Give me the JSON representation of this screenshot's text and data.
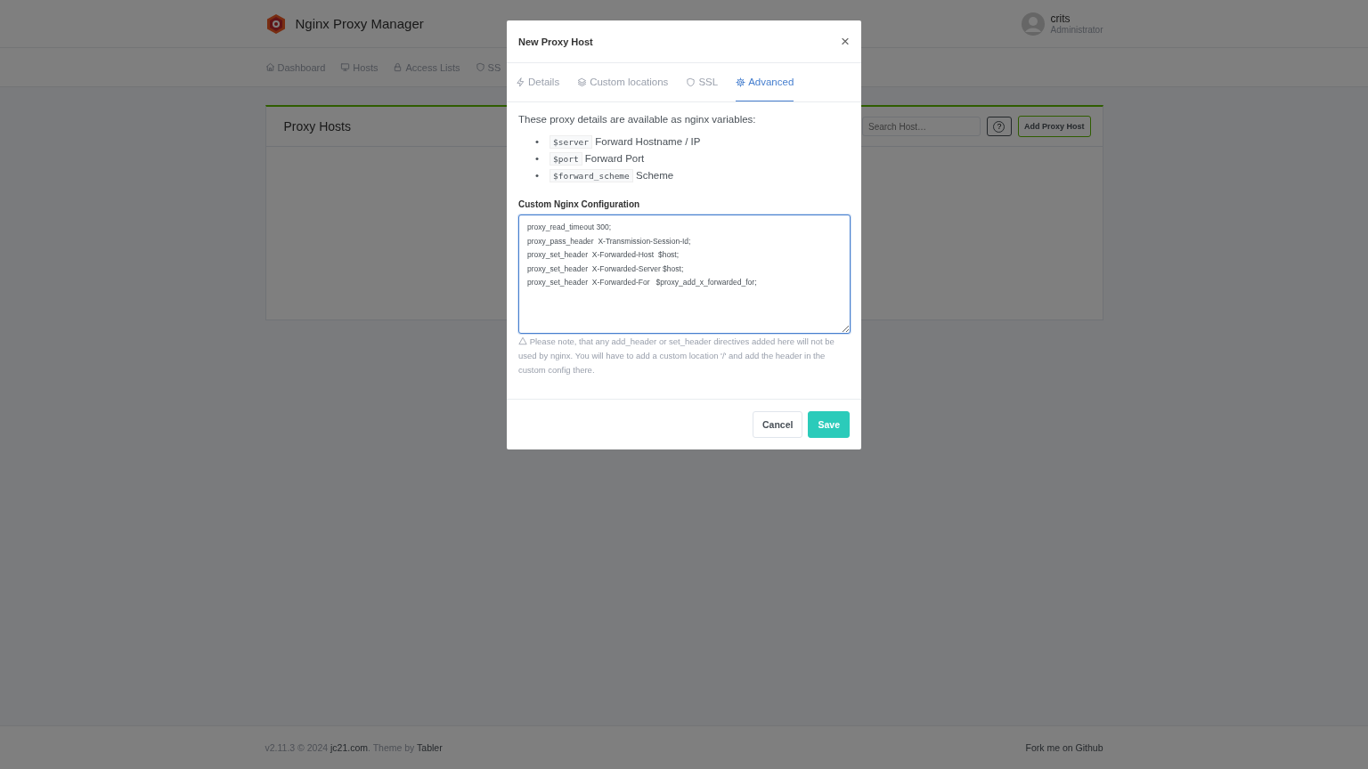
{
  "header": {
    "app_name": "Nginx Proxy Manager",
    "user": {
      "name": "crits",
      "role": "Administrator"
    }
  },
  "nav": [
    {
      "label": "Dashboard"
    },
    {
      "label": "Hosts"
    },
    {
      "label": "Access Lists"
    },
    {
      "label": "SS"
    }
  ],
  "card": {
    "title": "Proxy Hosts",
    "search": {
      "placeholder": "Search Host…"
    },
    "help_button": "?",
    "add_button": "Add Proxy Host"
  },
  "modal": {
    "title": "New Proxy Host",
    "close": "×",
    "tabs": [
      {
        "label": "Details",
        "selected": false
      },
      {
        "label": "Custom locations",
        "selected": false
      },
      {
        "label": "SSL",
        "selected": false
      },
      {
        "label": "Advanced",
        "selected": true
      }
    ],
    "intro": "These proxy details are available as nginx variables:",
    "variables": [
      {
        "bullet": "•",
        "code": "$server",
        "description": "Forward Hostname / IP"
      },
      {
        "bullet": "•",
        "code": "$port",
        "description": "Forward Port"
      },
      {
        "bullet": "•",
        "code": "$forward_scheme",
        "description": "Scheme"
      }
    ],
    "config_label": "Custom Nginx Configuration",
    "config_value": "proxy_read_timeout 300;\nproxy_pass_header  X-Transmission-Session-Id;\nproxy_set_header  X-Forwarded-Host  $host;\nproxy_set_header  X-Forwarded-Server $host;\nproxy_set_header  X-Forwarded-For   $proxy_add_x_forwarded_for; ",
    "note": "Please note, that any add_header or set_header directives added here will not be used by nginx. You will have to add a custom location '/' and add the header in the custom config there.",
    "buttons": [
      {
        "label": "Cancel",
        "kind": "secondary"
      },
      {
        "label": "Save",
        "kind": "primary"
      }
    ]
  },
  "footer": {
    "prefix": "v2.11.3 © 2024 ",
    "site_link": "jc21.com",
    "middle": ". Theme by ",
    "theme_link": "Tabler",
    "github_link": "Fork me on Github"
  }
}
